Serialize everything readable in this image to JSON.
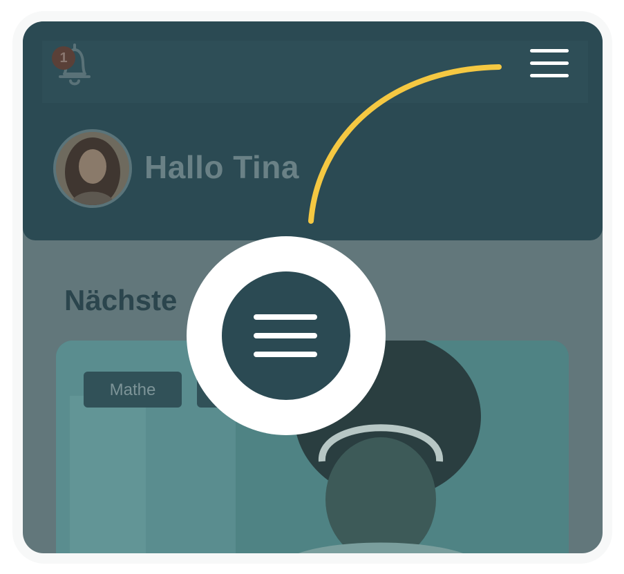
{
  "header": {
    "notification_count": "1",
    "greeting": "Hallo Tina"
  },
  "main": {
    "section_title_visible": "Nächste",
    "tags": [
      "Mathe",
      ""
    ]
  },
  "icons": {
    "notification": "bell-icon",
    "menu": "hamburger-menu-icon",
    "avatar": "user-avatar"
  },
  "colors": {
    "header_bg": "#2b4a53",
    "overlay": "#62777b",
    "highlight_arrow": "#f5c842",
    "spotlight": "#ffffff"
  }
}
